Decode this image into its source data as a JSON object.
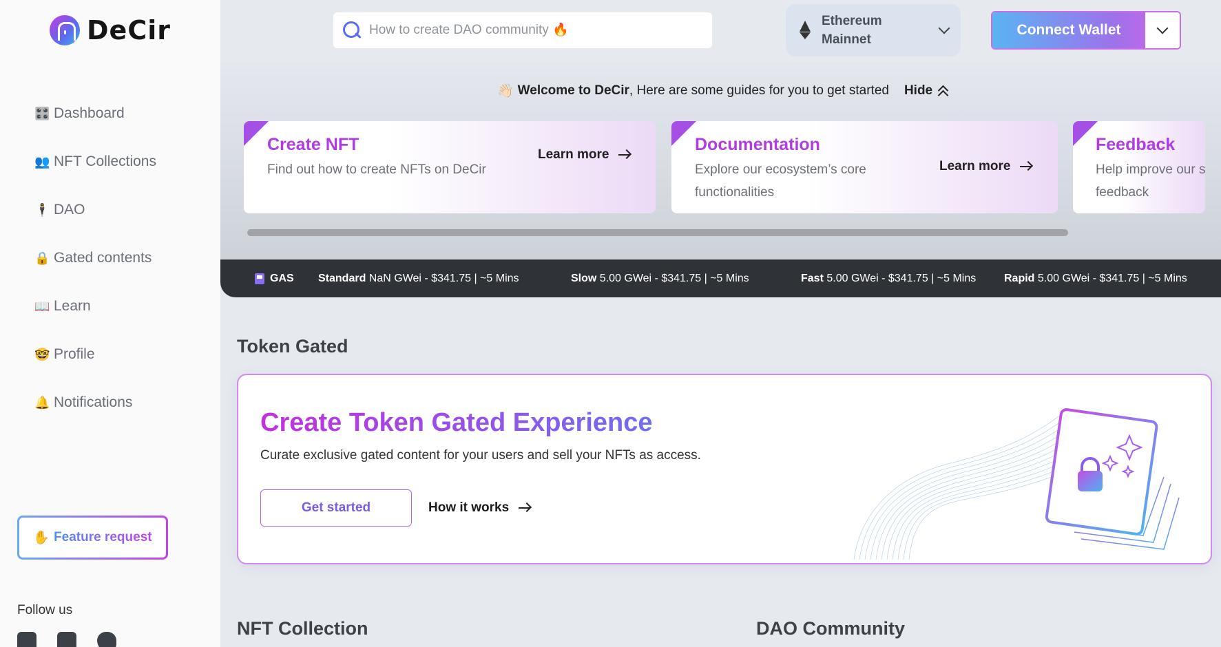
{
  "brand": {
    "name": "DeCir"
  },
  "sidebar": {
    "items": [
      {
        "icon": "🎛️",
        "label": "Dashboard"
      },
      {
        "icon": "👥",
        "label": "NFT Collections"
      },
      {
        "icon": "🕴",
        "label": "DAO"
      },
      {
        "icon": "🔒",
        "label": "Gated contents"
      },
      {
        "icon": "📖",
        "label": "Learn"
      },
      {
        "icon": "🤓",
        "label": "Profile"
      },
      {
        "icon": "🔔",
        "label": "Notifications"
      }
    ],
    "feature_request": {
      "icon": "✋",
      "label": "Feature request"
    },
    "follow_label": "Follow us",
    "socials": [
      "discord-icon",
      "linkedin-icon",
      "twitter-icon"
    ]
  },
  "header": {
    "search_placeholder": "How to create DAO community 🔥",
    "network": {
      "line1": "Ethereum",
      "line2": "Mainnet"
    },
    "wallet_label": "Connect Wallet"
  },
  "welcome": {
    "emoji": "👋🏻",
    "bold": "Welcome to DeCir",
    "rest": ", Here are some guides for you to get started",
    "hide_label": "Hide"
  },
  "guides": [
    {
      "title": "Create NFT",
      "desc": "Find out how to create NFTs on DeCir",
      "link": "Learn more"
    },
    {
      "title": "Documentation",
      "desc": "Explore our ecosystem’s core functionalities",
      "link": "Learn more"
    },
    {
      "title": "Feedback",
      "desc": "Help improve our s feedback",
      "link": ""
    }
  ],
  "gas": {
    "label": "GAS",
    "items": [
      {
        "name": "Standard",
        "value": "NaN GWei - $341.75 | ~5 Mins"
      },
      {
        "name": "Slow",
        "value": "5.00 GWei - $341.75 | ~5 Mins"
      },
      {
        "name": "Fast",
        "value": "5.00 GWei - $341.75 | ~5 Mins"
      },
      {
        "name": "Rapid",
        "value": "5.00 GWei - $341.75 | ~5 Mins"
      }
    ]
  },
  "token_gated": {
    "section_title": "Token Gated",
    "title": "Create Token Gated Experience",
    "desc": "Curate exclusive gated content for your users and sell your NFTs as access.",
    "start_label": "Get started",
    "how_label": "How it works"
  },
  "bottom": {
    "left_title": "NFT Collection",
    "right_title": "DAO Community"
  },
  "colors": {
    "accent_purple": "#b03de2",
    "accent_blue": "#5ab4f4",
    "dark_bar": "#2f3338"
  }
}
